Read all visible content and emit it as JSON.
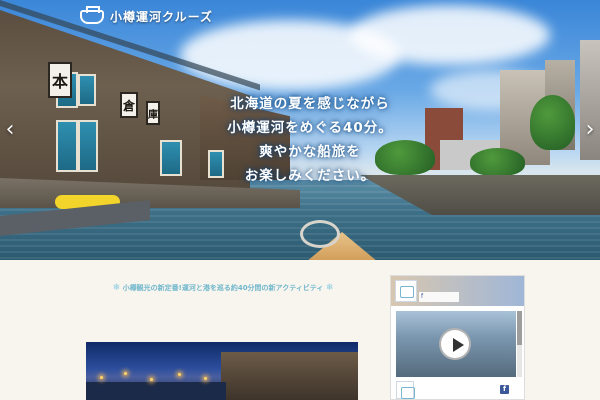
{
  "site": {
    "logo_text": "小樽運河クルーズ"
  },
  "hero": {
    "catch_lines": [
      "北海道の夏を感じながら",
      "小樽運河をめぐる40分。",
      "爽やかな船旅を",
      "お楽しみください。"
    ],
    "plates": [
      "本",
      "倉",
      "庫"
    ],
    "prev_arrow": "‹",
    "next_arrow": "›"
  },
  "intro": {
    "deco_left": "❄",
    "heading": "小樽観光の新定番!運河と港を巡る約40分間の新アクティビティ",
    "deco_right": "❄"
  },
  "sidebar": {
    "share_label": "f",
    "fb_icon": "f"
  }
}
